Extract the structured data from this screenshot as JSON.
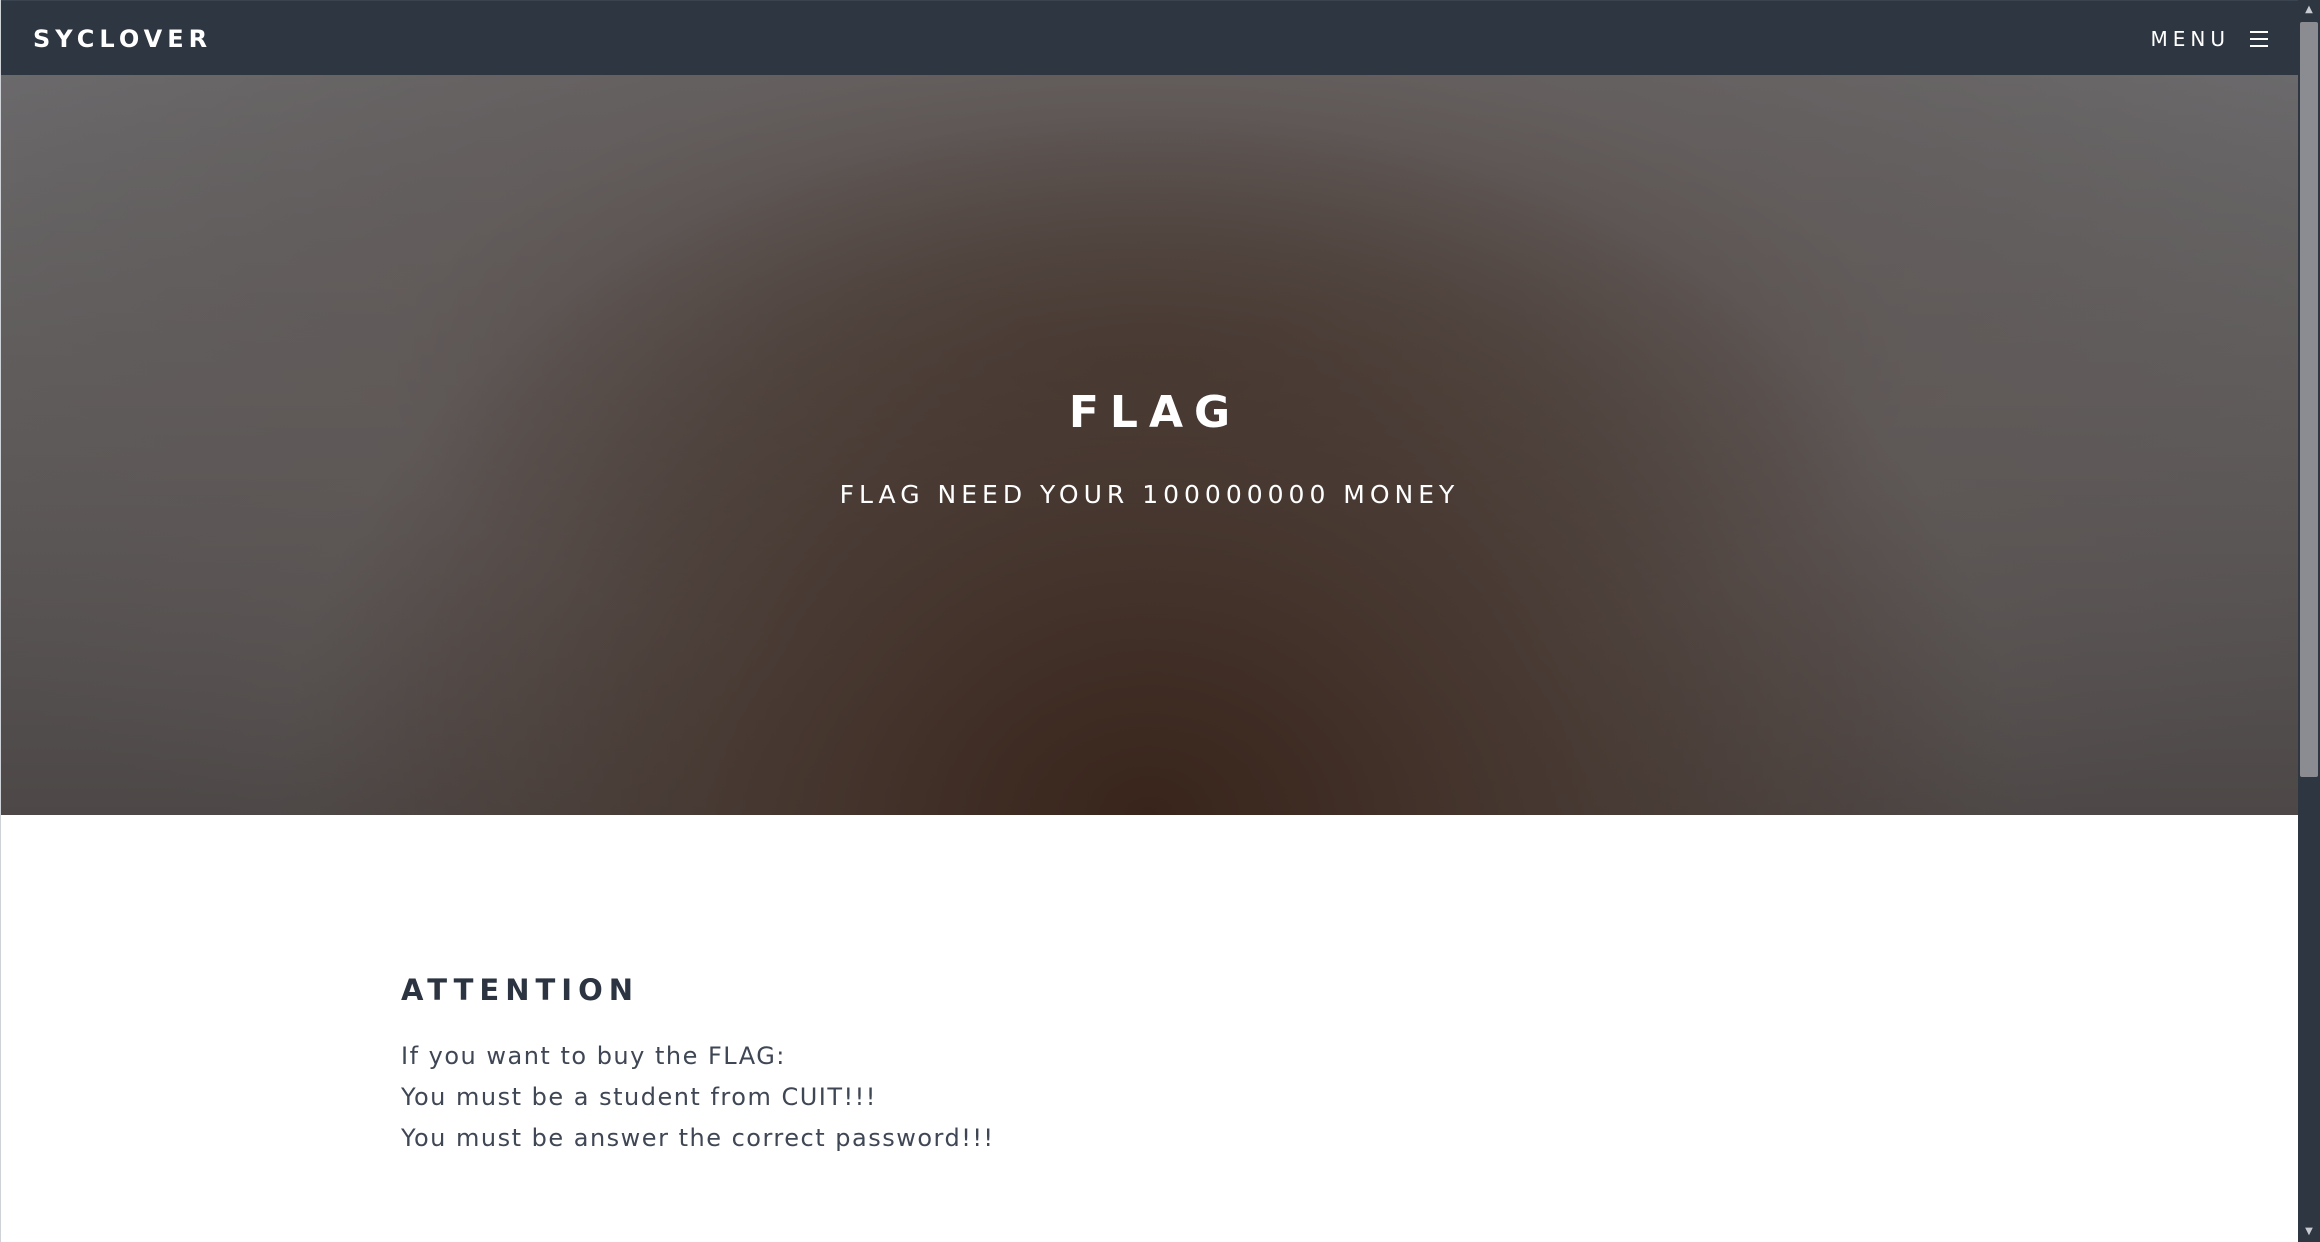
{
  "navbar": {
    "brand": "SYCLOVER",
    "menu_label": "MENU",
    "menu_icon": "hamburger-icon",
    "background": "#2e3641"
  },
  "hero": {
    "title": "FLAG",
    "subtitle": "FLAG NEED YOUR 100000000 MONEY"
  },
  "attention": {
    "heading": "ATTENTION",
    "lines": [
      "If you want to buy the FLAG:",
      "You must be a student from CUIT!!!",
      "You must be answer the correct password!!!"
    ]
  },
  "scrollbar": {
    "position_fraction": 0.0,
    "visible_fraction": 0.63,
    "up_icon": "arrow-up-icon",
    "down_icon": "arrow-down-icon"
  },
  "colors": {
    "nav_background": "#2e3641",
    "heading_text": "#2b3440",
    "body_text": "#3f4654",
    "hero_text": "#ffffff"
  }
}
